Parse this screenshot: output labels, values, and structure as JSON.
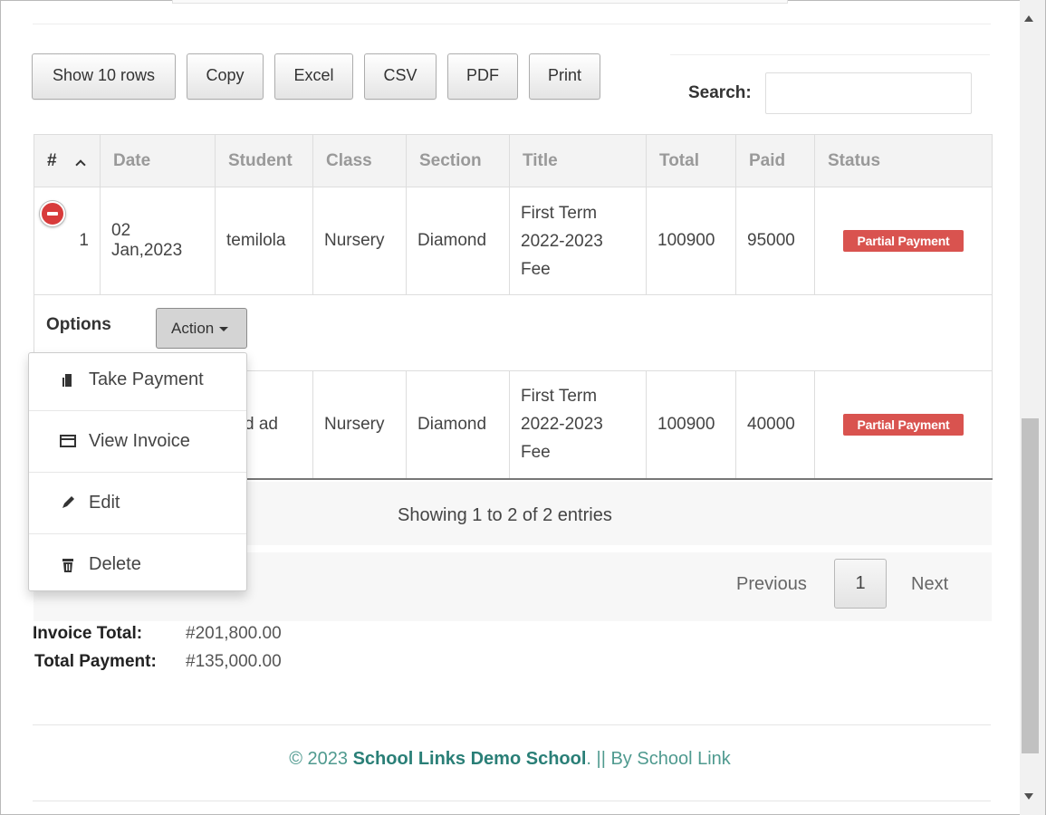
{
  "toolbar": {
    "buttons": [
      "Show 10 rows",
      "Copy",
      "Excel",
      "CSV",
      "PDF",
      "Print"
    ],
    "search_label": "Search:",
    "search_value": ""
  },
  "table": {
    "headers": [
      "#",
      "Date",
      "Student",
      "Class",
      "Section",
      "Title",
      "Total",
      "Paid",
      "Status"
    ],
    "rows": [
      {
        "num": "1",
        "date_line1": "02",
        "date_line2": "Jan,2023",
        "student": "temilola",
        "class": "Nursery",
        "section": "Diamond",
        "title_line1": "First Term",
        "title_line2": "2022-2023",
        "title_line3": "Fee",
        "total": "100900",
        "paid": "95000",
        "status": "Partial Payment"
      },
      {
        "student_partial": "d ad",
        "class": "Nursery",
        "section": "Diamond",
        "title_line1": "First Term",
        "title_line2": "2022-2023",
        "title_line3": "Fee",
        "total": "100900",
        "paid": "40000",
        "status": "Partial Payment"
      }
    ],
    "options_label": "Options",
    "action_label": "Action"
  },
  "action_menu": {
    "items": [
      "Take Payment",
      "View Invoice",
      "Edit",
      "Delete"
    ]
  },
  "info": "Showing 1 to 2 of 2 entries",
  "pagination": {
    "previous": "Previous",
    "page": "1",
    "next": "Next"
  },
  "totals": {
    "invoice_label": "Invoice Total:",
    "invoice_value": "#201,800.00",
    "payment_label": "Total Payment:",
    "payment_value": "#135,000.00"
  },
  "footer": {
    "copyright": "© 2023",
    "school": "School Links Demo School",
    "by": ". || By School Link"
  },
  "colors": {
    "status_badge": "#d9534f",
    "footer_text": "#4f9a8f",
    "footer_brand": "#2a7f77"
  }
}
